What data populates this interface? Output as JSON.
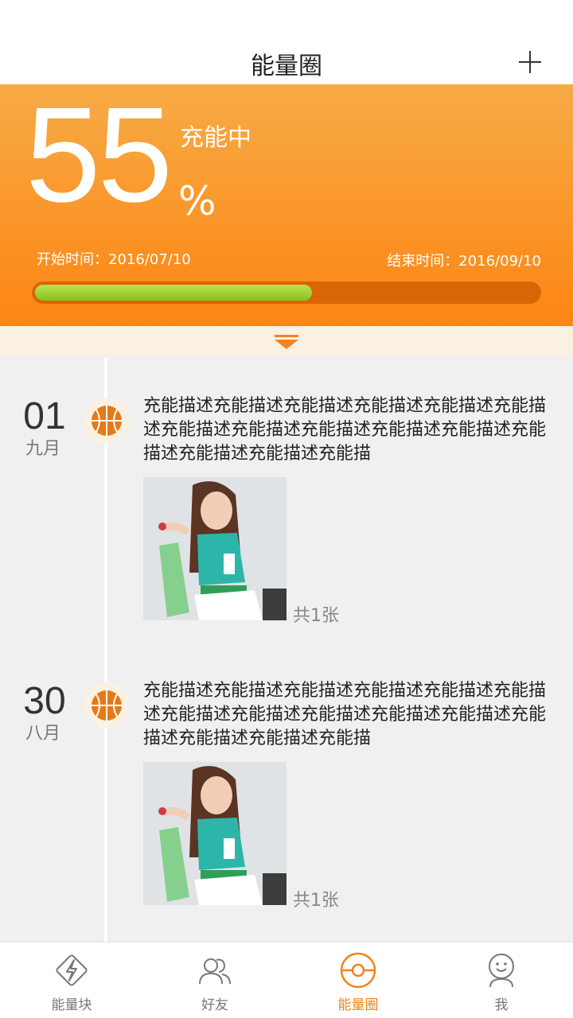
{
  "header": {
    "title": "能量圈"
  },
  "hero": {
    "percent": "55",
    "percent_sign": "%",
    "status": "充能中",
    "progress": 0.55,
    "start_date": "开始时间：2016/07/10",
    "end_date": "结束时间：2016/09/10"
  },
  "entries": [
    {
      "day": "01",
      "month": "九月",
      "description": "充能描述充能描述充能描述充能描述充能描述充能描述充能描述充能描述充能描述充能描述充能描述充能描述充能描述充能描述充能描",
      "count": "共1张"
    },
    {
      "day": "30",
      "month": "八月",
      "description": "充能描述充能描述充能描述充能描述充能描述充能描述充能描述充能描述充能描述充能描述充能描述充能描述充能描述充能描述充能描",
      "count": "共1张"
    }
  ],
  "tabs": [
    {
      "label": "能量块",
      "icon": "lightning-icon"
    },
    {
      "label": "好友",
      "icon": "friends-icon"
    },
    {
      "label": "能量圈",
      "icon": "energy-circle-icon",
      "active": true
    },
    {
      "label": "我",
      "icon": "profile-icon"
    }
  ],
  "colors": {
    "accent": "#f08418",
    "hero_top": "#f7ab46",
    "hero_bottom": "#fd8513",
    "progress_fill": "#9fd131"
  }
}
